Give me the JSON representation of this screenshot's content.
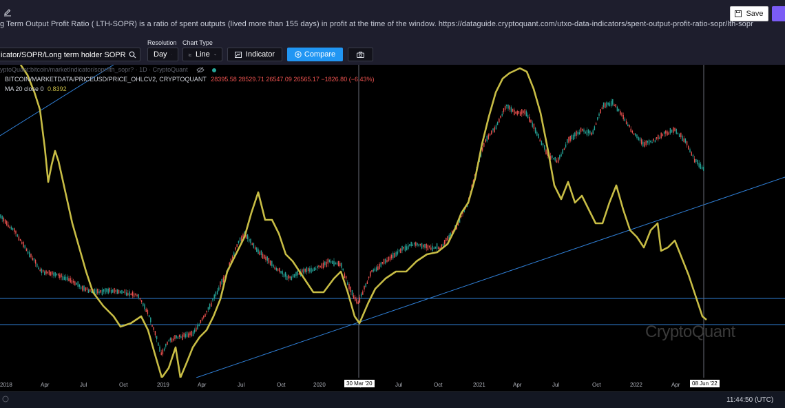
{
  "header": {
    "description": "g Term Output Profit Ratio ( LTH-SOPR) is a ratio of spent outputs (lived more than 155 days) in profit at the time of the window. https://dataguide.cryptoquant.com/utxo-data-indicators/spent-output-profit-ratio-sopr/lth-sopr",
    "save_label": "Save"
  },
  "toolbar": {
    "indicator_path": "icator/SOPR/Long term holder SOPR",
    "resolution_label": "Resolution",
    "resolution_value": "Day",
    "chart_type_label": "Chart Type",
    "chart_type_value": "Line",
    "indicator_label": "Indicator",
    "compare_label": "Compare"
  },
  "legend": {
    "symbol": "yptoQuant:bitcoin/marketIndicator/sopr/lth_sopr? · 1D · CryptoQuant",
    "series_name": "BITCOIN/MARKETDATA/PRICEUSD/PRICE_OHLCV2, CRYPTOQUANT",
    "ohlc": "28395.58  28529.71  26547.09  26565.17  −1826.80 (−6.43%)",
    "ma_label": "MA 20 close 0",
    "ma_value": "0.8392"
  },
  "chart_data": {
    "type": "line",
    "x_ticks": [
      "2018",
      "Apr",
      "Jul",
      "Oct",
      "2019",
      "Apr",
      "Jul",
      "Oct",
      "2020",
      "Apr",
      "Jul",
      "Oct",
      "2021",
      "Apr",
      "Jul",
      "Oct",
      "2022",
      "Apr"
    ],
    "crosshair_dates": [
      "30 Mar '20",
      "08 Jun '22"
    ],
    "series": [
      {
        "name": "LTH-SOPR",
        "color": "#c8bd45"
      },
      {
        "name": "BITCOIN/MARKETDATA/PRICEUSD/PRICE_OHLCV2",
        "color": "#c0392b"
      }
    ],
    "watermark": "CryptoQuant"
  },
  "status": {
    "clock": "11:44:50 (UTC)"
  },
  "colors": {
    "accent": "#2196f3",
    "sopr": "#c8bd45",
    "trendline": "#2f7fd6",
    "candle_up": "#26a69a",
    "candle_down": "#ef5350"
  }
}
